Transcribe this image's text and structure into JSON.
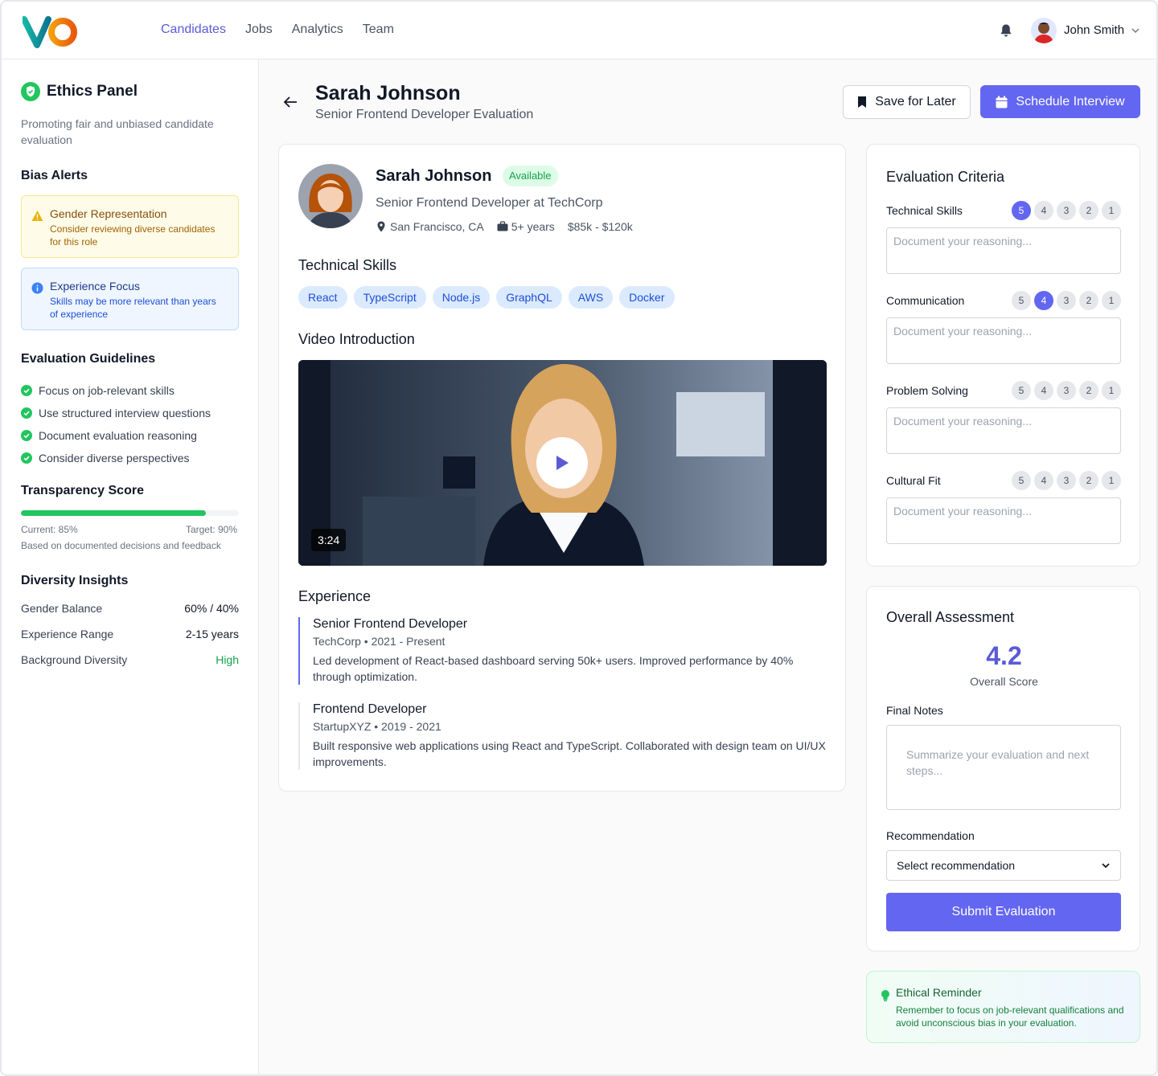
{
  "header": {
    "nav": [
      {
        "label": "Candidates",
        "active": true
      },
      {
        "label": "Jobs",
        "active": false
      },
      {
        "label": "Analytics",
        "active": false
      },
      {
        "label": "Team",
        "active": false
      }
    ],
    "user_name": "John Smith"
  },
  "sidebar": {
    "title": "Ethics Panel",
    "description": "Promoting fair and unbiased candidate evaluation",
    "bias_alerts_heading": "Bias Alerts",
    "alerts": [
      {
        "title": "Gender Representation",
        "text": "Consider reviewing diverse candidates for this role"
      },
      {
        "title": "Experience Focus",
        "text": "Skills may be more relevant than years of experience"
      }
    ],
    "guidelines_heading": "Evaluation Guidelines",
    "guidelines": [
      "Focus on job-relevant skills",
      "Use structured interview questions",
      "Document evaluation reasoning",
      "Consider diverse perspectives"
    ],
    "transparency": {
      "heading": "Transparency Score",
      "current_label": "Current: 85%",
      "target_label": "Target: 90%",
      "fill_percent": 85,
      "note": "Based on documented decisions and feedback"
    },
    "diversity": {
      "heading": "Diversity Insights",
      "rows": [
        {
          "label": "Gender Balance",
          "value": "60% / 40%"
        },
        {
          "label": "Experience Range",
          "value": "2-15 years"
        },
        {
          "label": "Background Diversity",
          "value": "High"
        }
      ]
    }
  },
  "page": {
    "title": "Sarah Johnson",
    "subtitle": "Senior Frontend Developer Evaluation",
    "save_label": "Save for Later",
    "schedule_label": "Schedule Interview"
  },
  "candidate": {
    "name": "Sarah Johnson",
    "status": "Available",
    "role": "Senior Frontend Developer at TechCorp",
    "location": "San Francisco, CA",
    "experience": "5+ years",
    "salary": "$85k - $120k",
    "skills_heading": "Technical Skills",
    "skills": [
      "React",
      "TypeScript",
      "Node.js",
      "GraphQL",
      "AWS",
      "Docker"
    ],
    "video_heading": "Video Introduction",
    "video_duration": "3:24",
    "experience_heading": "Experience",
    "jobs": [
      {
        "title": "Senior Frontend Developer",
        "company": "TechCorp • 2021 - Present",
        "description": "Led development of React-based dashboard serving 50k+ users. Improved performance by 40% through optimization."
      },
      {
        "title": "Frontend Developer",
        "company": "StartupXYZ • 2019 - 2021",
        "description": "Built responsive web applications using React and TypeScript. Collaborated with design team on UI/UX improvements."
      }
    ]
  },
  "criteria": {
    "title": "Evaluation Criteria",
    "placeholder": "Document your reasoning...",
    "items": [
      {
        "label": "Technical Skills",
        "selected": 5
      },
      {
        "label": "Communication",
        "selected": 4
      },
      {
        "label": "Problem Solving",
        "selected": null
      },
      {
        "label": "Cultural Fit",
        "selected": null
      }
    ],
    "scale": [
      "5",
      "4",
      "3",
      "2",
      "1"
    ]
  },
  "assessment": {
    "title": "Overall Assessment",
    "score": "4.2",
    "score_label": "Overall Score",
    "notes_label": "Final Notes",
    "notes_placeholder": "Summarize your evaluation and next steps...",
    "recommendation_label": "Recommendation",
    "recommendation_value": "Select recommendation",
    "submit_label": "Submit Evaluation"
  },
  "reminder": {
    "title": "Ethical Reminder",
    "text": "Remember to focus on job-relevant qualifications and avoid unconscious bias in your evaluation."
  },
  "colors": {
    "accent": "#6366f1",
    "success": "#22c55e",
    "warning_bg": "#fefce8",
    "info_bg": "#eff6ff"
  }
}
